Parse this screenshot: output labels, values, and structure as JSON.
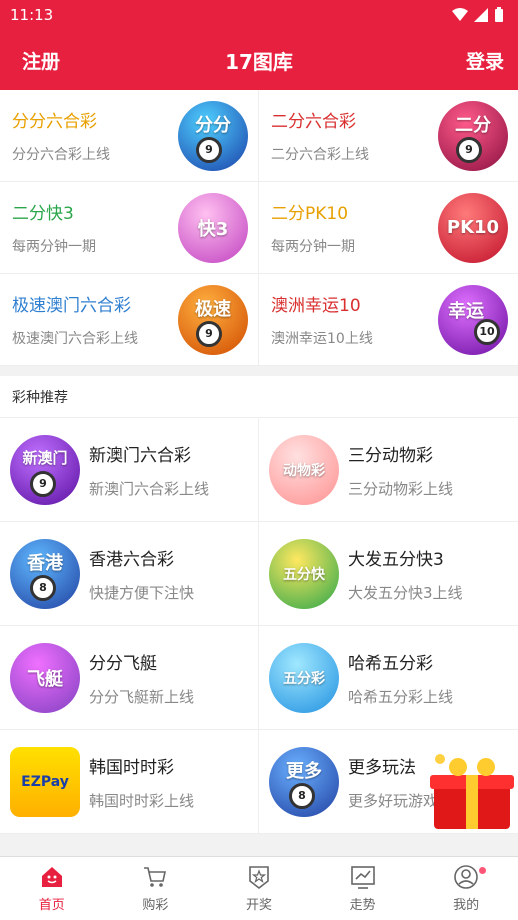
{
  "status": {
    "time": "11:13"
  },
  "header": {
    "left": "注册",
    "title": "17图库",
    "right": "登录"
  },
  "featured": [
    {
      "name": "分分六合彩",
      "sub": "分分六合彩上线",
      "color": "#e8a000",
      "icon_text": "分分"
    },
    {
      "name": "二分六合彩",
      "sub": "二分六合彩上线",
      "color": "#d92f2f",
      "icon_text": "二分"
    },
    {
      "name": "二分快3",
      "sub": "每两分钟一期",
      "color": "#2aa64a",
      "icon_text": "快3"
    },
    {
      "name": "二分PK10",
      "sub": "每两分钟一期",
      "color": "#e8a000",
      "icon_text": "PK10"
    },
    {
      "name": "极速澳门六合彩",
      "sub": "极速澳门六合彩上线",
      "color": "#2f7fd0",
      "icon_text": "极速"
    },
    {
      "name": "澳洲幸运10",
      "sub": "澳洲幸运10上线",
      "color": "#d92f2f",
      "icon_text": "幸运"
    }
  ],
  "section_title": "彩种推荐",
  "recommend": [
    {
      "name": "新澳门六合彩",
      "sub": "新澳门六合彩上线",
      "icon_text": "新澳门"
    },
    {
      "name": "三分动物彩",
      "sub": "三分动物彩上线",
      "icon_text": "动物彩"
    },
    {
      "name": "香港六合彩",
      "sub": "快捷方便下注快",
      "icon_text": "香港"
    },
    {
      "name": "大发五分快3",
      "sub": "大发五分快3上线",
      "icon_text": "五分快"
    },
    {
      "name": "分分飞艇",
      "sub": "分分飞艇新上线",
      "icon_text": "飞艇"
    },
    {
      "name": "哈希五分彩",
      "sub": "哈希五分彩上线",
      "icon_text": "五分彩"
    },
    {
      "name": "韩国时时彩",
      "sub": "韩国时时彩上线",
      "icon_text": "EZPay"
    },
    {
      "name": "更多玩法",
      "sub": "更多好玩游戏",
      "icon_text": "更多"
    }
  ],
  "tabs": [
    {
      "label": "首页",
      "icon": "home-icon"
    },
    {
      "label": "购彩",
      "icon": "cart-icon"
    },
    {
      "label": "开奖",
      "icon": "award-icon"
    },
    {
      "label": "走势",
      "icon": "trend-icon"
    },
    {
      "label": "我的",
      "icon": "user-icon"
    }
  ],
  "colors": {
    "brand": "#e8203f"
  }
}
